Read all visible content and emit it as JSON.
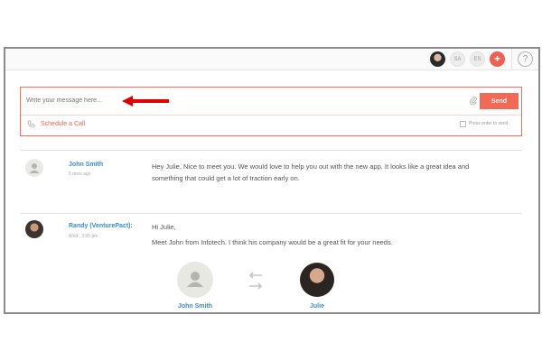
{
  "header": {
    "avatars": [
      {
        "initials": "",
        "icon": "user-photo"
      },
      {
        "initials": "SA"
      },
      {
        "initials": "ES"
      }
    ],
    "add_label": "+",
    "help_label": "?"
  },
  "composer": {
    "placeholder": "Write your message here...",
    "send_label": "Send",
    "schedule_label": "Schedule a Call",
    "enter_label": "Press enter to send",
    "accent": "#f26a55"
  },
  "messages": [
    {
      "name": "John Smith",
      "time": "5 mins ago",
      "lines": [
        "Hey Julie, Nice to meet you. We would love to help you out with the new app. It looks like a great idea and",
        "something that could get a lot of traction early on."
      ]
    },
    {
      "name": "Randy (VenturePact):",
      "time": "Wed , 3:05 pm",
      "lines": [
        "Hi Julie,",
        "Meet John from Infotech. I think his company would be a great fit for your needs."
      ]
    }
  ],
  "introduction": {
    "left_name": "John Smith",
    "right_name": "Julie"
  }
}
